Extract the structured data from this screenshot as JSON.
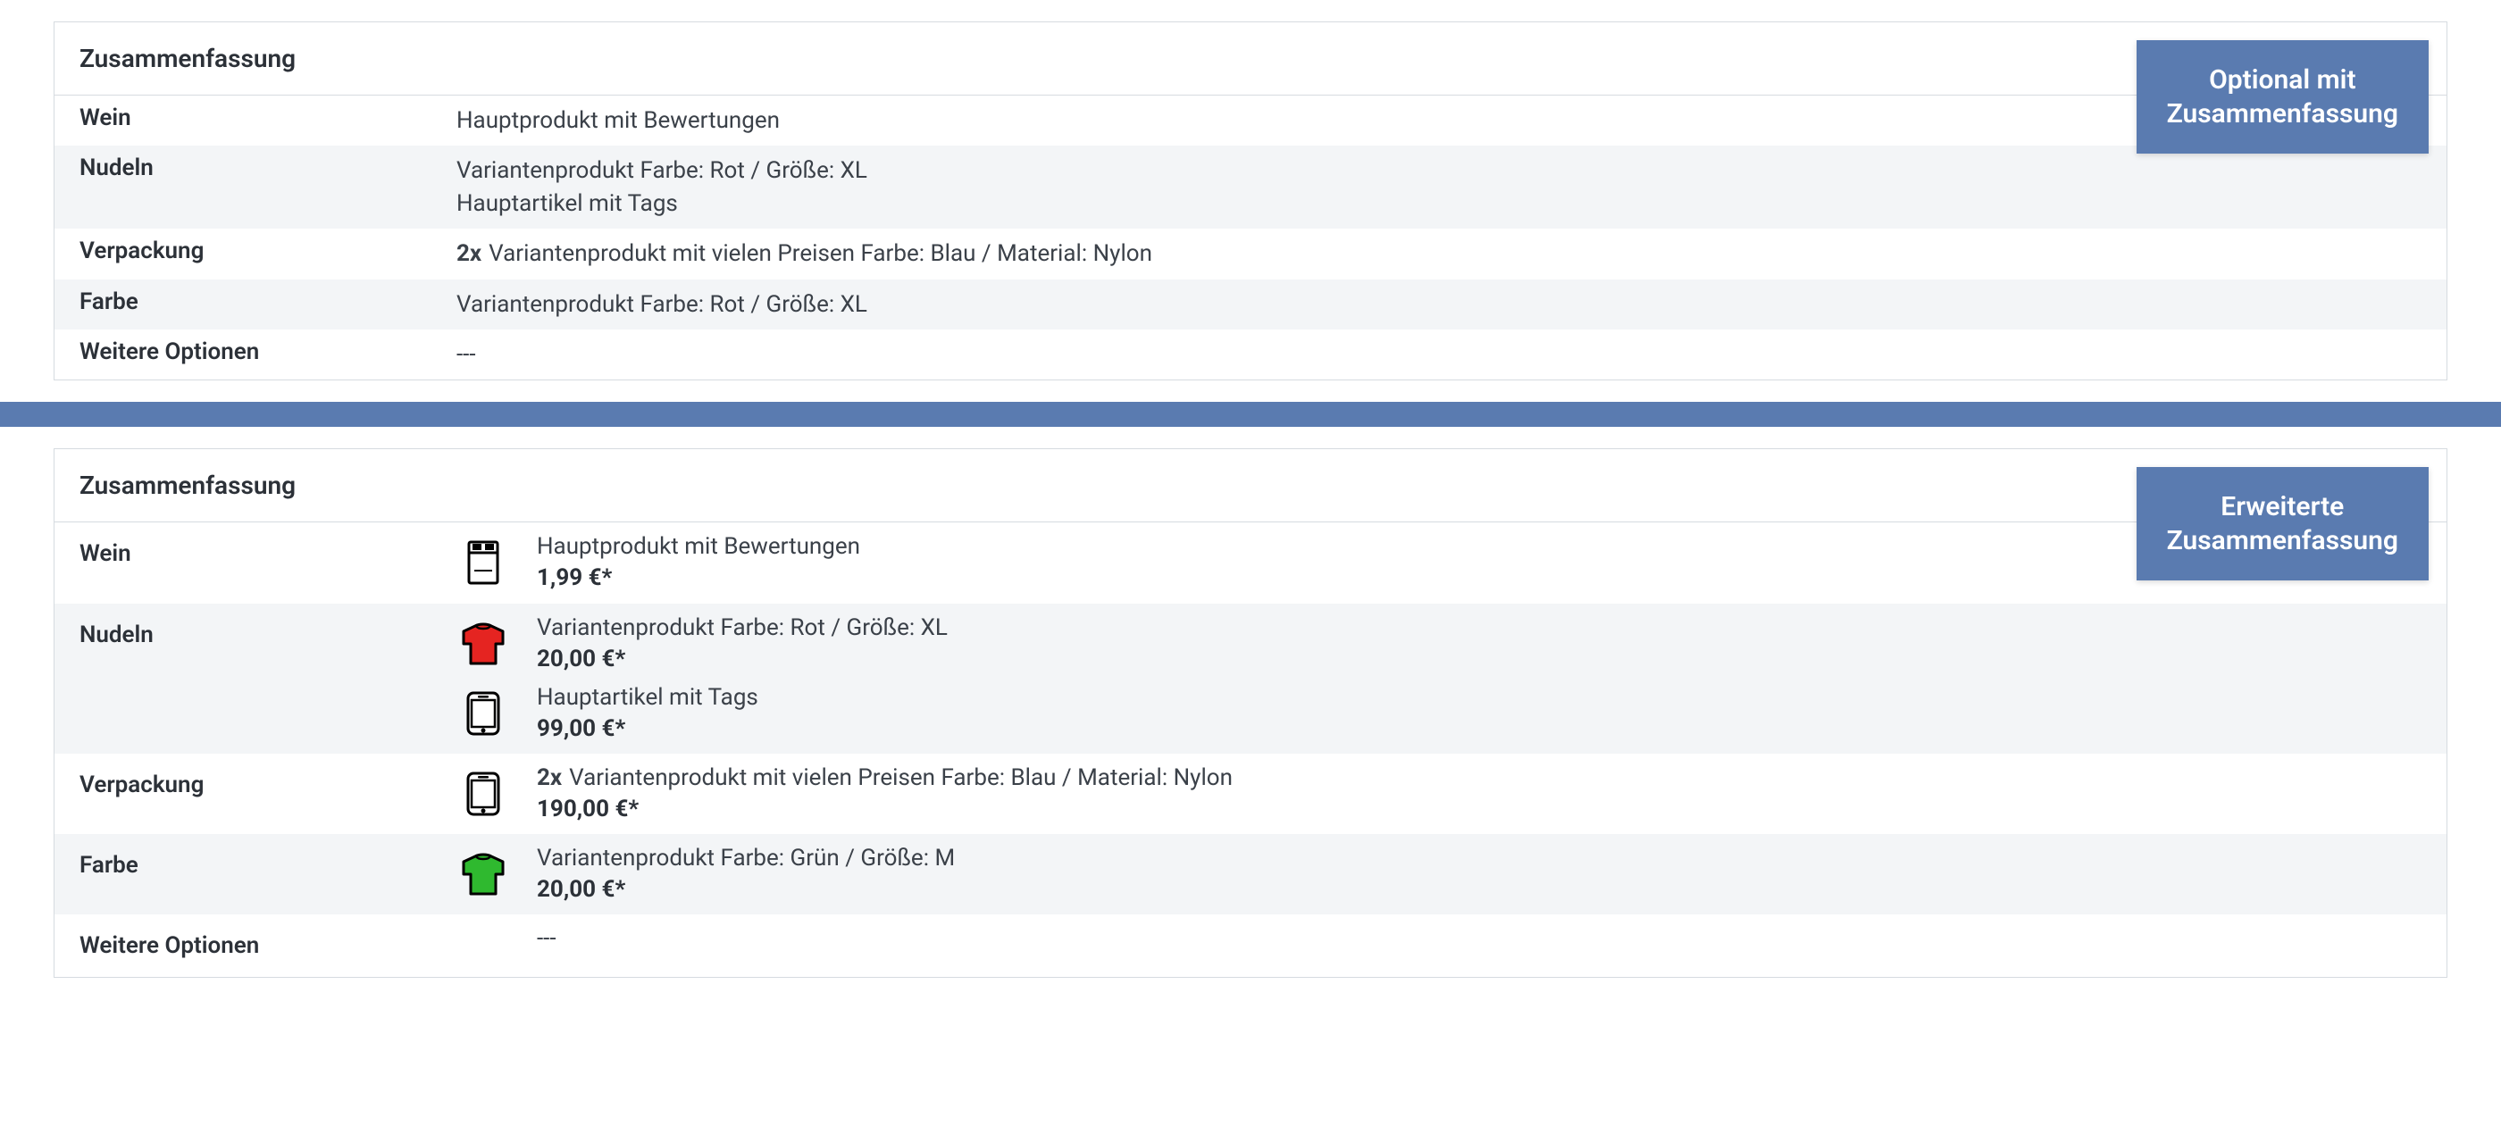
{
  "panel1": {
    "title": "Zusammenfassung",
    "badge": "Optional mit\nZusammenfassung",
    "rows": [
      {
        "label": "Wein",
        "lines": [
          {
            "qty": "",
            "text": "Hauptprodukt mit Bewertungen"
          }
        ]
      },
      {
        "label": "Nudeln",
        "lines": [
          {
            "qty": "",
            "text": "Variantenprodukt Farbe: Rot / Größe: XL"
          },
          {
            "qty": "",
            "text": "Hauptartikel mit Tags"
          }
        ]
      },
      {
        "label": "Verpackung",
        "lines": [
          {
            "qty": "2x",
            "text": "Variantenprodukt mit vielen Preisen Farbe: Blau / Material: Nylon"
          }
        ]
      },
      {
        "label": "Farbe",
        "lines": [
          {
            "qty": "",
            "text": "Variantenprodukt Farbe: Rot / Größe: XL"
          }
        ]
      },
      {
        "label": "Weitere Optionen",
        "lines": [
          {
            "qty": "",
            "text": "---"
          }
        ]
      }
    ]
  },
  "panel2": {
    "title": "Zusammenfassung",
    "badge": "Erweiterte\nZusammenfassung",
    "rows": [
      {
        "label": "Wein",
        "items": [
          {
            "icon": "chocolate-icon",
            "qty": "",
            "text": "Hauptprodukt mit Bewertungen",
            "price": "1,99 €*"
          }
        ]
      },
      {
        "label": "Nudeln",
        "items": [
          {
            "icon": "shirt-red-icon",
            "qty": "",
            "text": "Variantenprodukt Farbe: Rot / Größe: XL",
            "price": "20,00 €*"
          },
          {
            "icon": "phone-icon",
            "qty": "",
            "text": "Hauptartikel mit Tags",
            "price": "99,00 €*"
          }
        ]
      },
      {
        "label": "Verpackung",
        "items": [
          {
            "icon": "phone-icon",
            "qty": "2x",
            "text": "Variantenprodukt mit vielen Preisen Farbe: Blau / Material: Nylon",
            "price": "190,00 €*"
          }
        ]
      },
      {
        "label": "Farbe",
        "items": [
          {
            "icon": "shirt-green-icon",
            "qty": "",
            "text": "Variantenprodukt Farbe: Grün / Größe: M",
            "price": "20,00 €*"
          }
        ]
      },
      {
        "label": "Weitere Optionen",
        "items": [
          {
            "icon": "",
            "qty": "",
            "text": "---",
            "price": ""
          }
        ]
      }
    ]
  }
}
